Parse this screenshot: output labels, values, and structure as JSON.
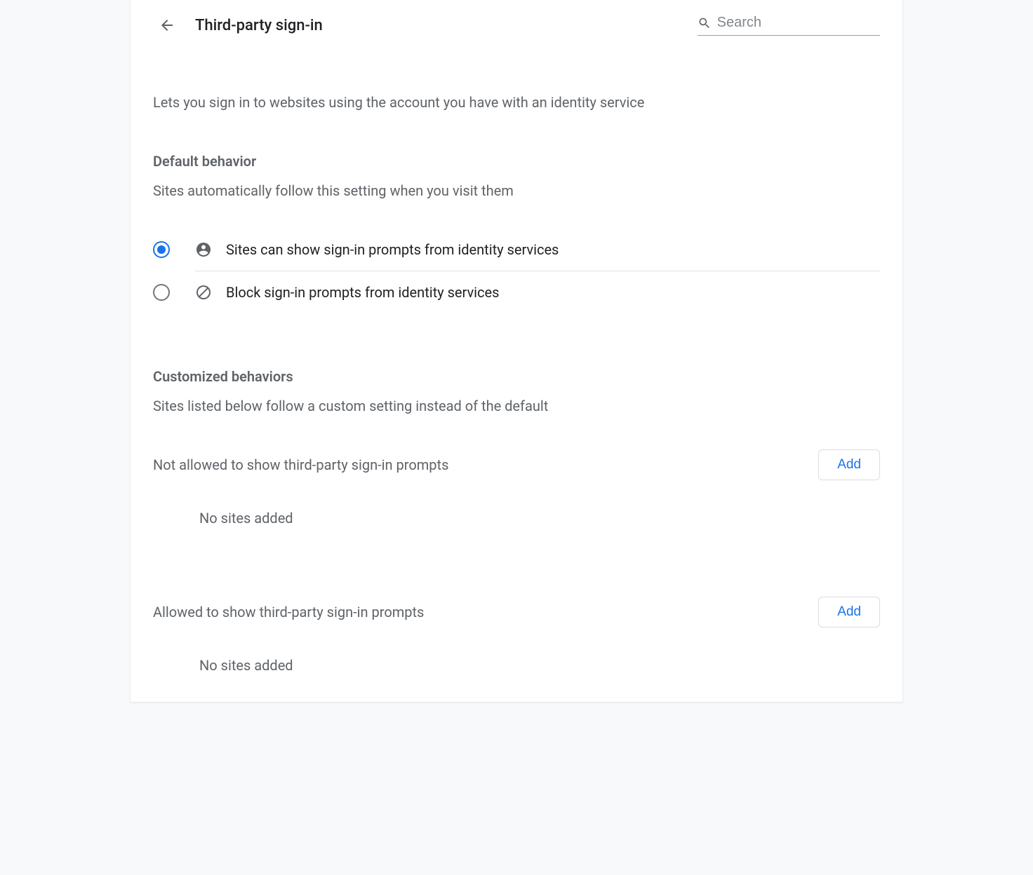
{
  "header": {
    "title": "Third-party sign-in",
    "search_placeholder": "Search"
  },
  "intro": "Lets you sign in to websites using the account you have with an identity service",
  "default_section": {
    "title": "Default behavior",
    "desc": "Sites automatically follow this setting when you visit them",
    "options": {
      "allow_label": "Sites can show sign-in prompts from identity services",
      "block_label": "Block sign-in prompts from identity services"
    }
  },
  "custom_section": {
    "title": "Customized behaviors",
    "desc": "Sites listed below follow a custom setting instead of the default",
    "not_allowed": {
      "title": "Not allowed to show third-party sign-in prompts",
      "add_label": "Add",
      "empty": "No sites added"
    },
    "allowed": {
      "title": "Allowed to show third-party sign-in prompts",
      "add_label": "Add",
      "empty": "No sites added"
    }
  }
}
